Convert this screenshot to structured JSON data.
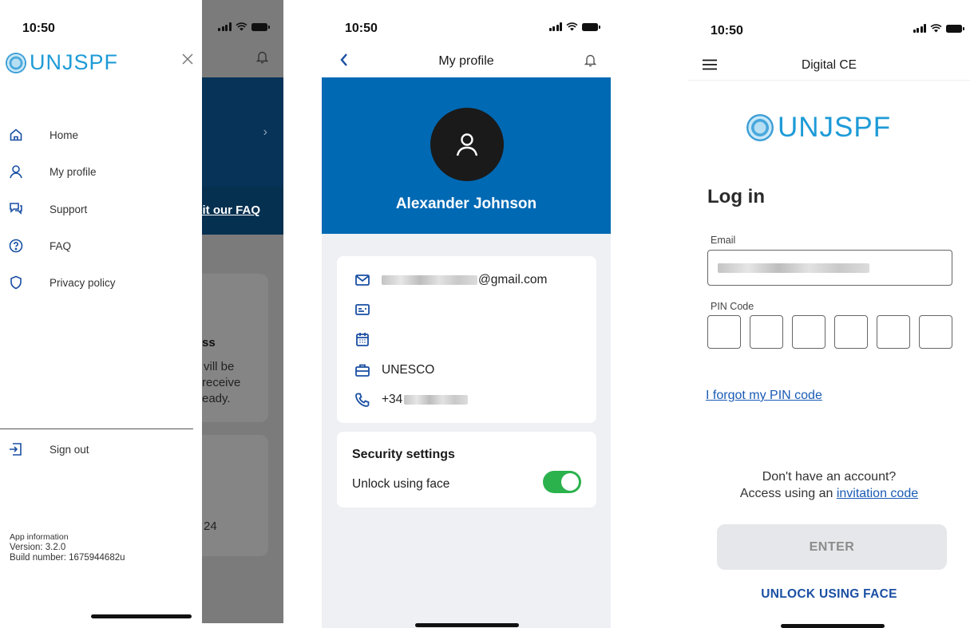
{
  "status_bar": {
    "time": "10:50"
  },
  "drawer": {
    "brand": "UNJSPF",
    "menu": [
      {
        "label": "Home",
        "icon": "home-icon"
      },
      {
        "label": "My profile",
        "icon": "user-icon"
      },
      {
        "label": "Support",
        "icon": "chat-icon"
      },
      {
        "label": "FAQ",
        "icon": "help-icon"
      },
      {
        "label": "Privacy policy",
        "icon": "shield-icon"
      }
    ],
    "sign_out": "Sign out",
    "app_info_title": "App information",
    "version": "Version: 3.2.0",
    "build": "Build number: 1675944682u",
    "background": {
      "faq_link": "isit our FAQ",
      "card_title": "ss",
      "card_text_1": "vill be",
      "card_text_2": "receive",
      "card_text_3": "eady.",
      "card2_text": "24"
    }
  },
  "profile": {
    "title": "My profile",
    "name": "Alexander Johnson",
    "email_suffix": "@gmail.com",
    "organization": "UNESCO",
    "phone_prefix": "+34",
    "security_title": "Security settings",
    "unlock_face_label": "Unlock using face"
  },
  "login": {
    "app_title": "Digital CE",
    "brand": "UNJSPF",
    "heading": "Log in",
    "email_label": "Email",
    "pin_label": "PIN Code",
    "forgot_pin": "I forgot my PIN code",
    "no_account": "Don't have an account?",
    "access_using": "Access using an",
    "invitation_link": "invitation code",
    "enter_button": "ENTER",
    "unlock_face_button": "UNLOCK USING FACE"
  },
  "colors": {
    "brand_blue": "#1e9bd7",
    "profile_header": "#0069b4",
    "icon_blue": "#1a4fa3",
    "toggle_on": "#2bb24c",
    "dark_band": "#073358"
  }
}
